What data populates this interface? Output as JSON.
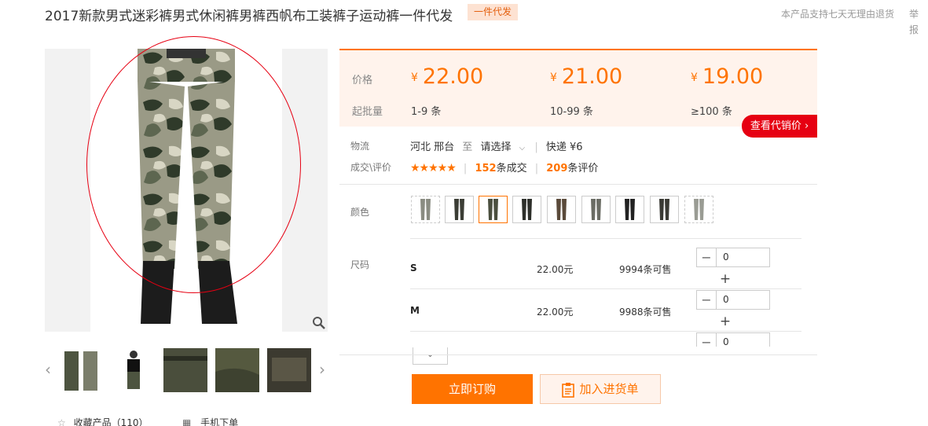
{
  "product": {
    "title": "2017新款男式迷彩裤男式休闲裤男裤西帆布工装裤子运动裤一件代发",
    "badge": "一件代发",
    "return_policy": "本产品支持七天无理由退货",
    "report": "举报"
  },
  "price_table": {
    "price_label": "价格",
    "qty_label": "起批量",
    "tiers": [
      {
        "currency": "¥",
        "price": "22.00",
        "range": "1-9 条"
      },
      {
        "currency": "¥",
        "price": "21.00",
        "range": "10-99 条"
      },
      {
        "currency": "¥",
        "price": "19.00",
        "range": "≥100 条"
      }
    ],
    "agent_price_button": "查看代销价 ›"
  },
  "logistics": {
    "label": "物流",
    "origin": "河北 邢台",
    "to": "至",
    "destination": "请选择",
    "shipping": "快递 ¥6"
  },
  "deals": {
    "label": "成交\\评价",
    "stars": "★★★★★",
    "deal_count": "152",
    "deal_text": "条成交",
    "review_count": "209",
    "review_text": "条评价"
  },
  "color": {
    "label": "颜色",
    "swatch_count": 9,
    "selected_index": 2
  },
  "sizes": {
    "label": "尺码",
    "items": [
      {
        "name": "S",
        "price": "22.00元",
        "stock": "9994条可售",
        "qty": "0"
      },
      {
        "name": "M",
        "price": "22.00元",
        "stock": "9988条可售",
        "qty": "0"
      },
      {
        "name": "",
        "price": "",
        "stock": "",
        "qty": "0"
      }
    ],
    "minus": "−",
    "plus": "+"
  },
  "actions": {
    "order": "立即订购",
    "add_to_cart": "加入进货单",
    "favorite": "收藏产品（110）",
    "mobile_order": "手机下单"
  },
  "colors": {
    "accent": "#ff7300",
    "red": "#e60012",
    "price_bg": "#fff3ec"
  }
}
